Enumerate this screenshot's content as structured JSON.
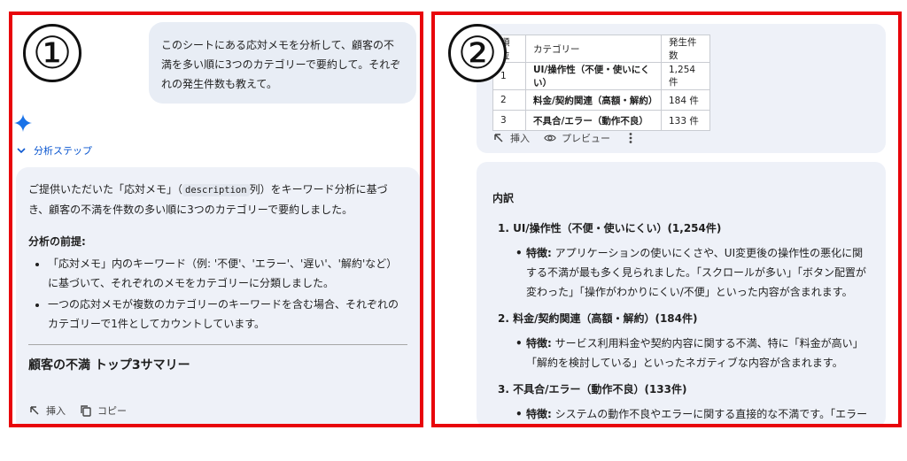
{
  "panel1": {
    "number": "①",
    "user_message": "このシートにある応対メモを分析して、顧客の不満を多い順に3つのカテゴリーで要約して。それぞれの発生件数も教えて。",
    "analysis_steps_label": "分析ステップ",
    "response": {
      "intro_1": "ご提供いただいた「応対メモ」（",
      "intro_code": "description",
      "intro_2": "列）をキーワード分析に基づき、顧客の不満を件数の多い順に3つのカテゴリーで要約しました。",
      "premise_heading": "分析の前提:",
      "bullets": [
        "「応対メモ」内のキーワード（例: '不便'、'エラー'、'遅い'、'解約'など）に基づいて、それぞれのメモをカテゴリーに分類しました。",
        "一つの応対メモが複数のカテゴリーのキーワードを含む場合、それぞれのカテゴリーで1件としてカウントしています。"
      ],
      "summary_title": "顧客の不満 トップ3サマリー"
    },
    "actions": {
      "insert_label": "挿入",
      "copy_label": "コピー"
    }
  },
  "panel2": {
    "number": "②",
    "table": {
      "headers": [
        "順位",
        "カテゴリー",
        "発生件数"
      ],
      "rows": [
        [
          "1",
          "UI/操作性（不便・使いにくい）",
          "1,254 件"
        ],
        [
          "2",
          "料金/契約関連（高額・解約）",
          "184 件"
        ],
        [
          "3",
          "不具合/エラー（動作不良）",
          "133 件"
        ]
      ]
    },
    "actions": {
      "insert_label": "挿入",
      "preview_label": "プレビュー"
    },
    "breakdown": {
      "title": "内訳",
      "items": [
        {
          "title": "1. UI/操作性（不便・使いにくい）(1,254件)",
          "feature_label": "特徴:",
          "feature_text": "アプリケーションの使いにくさや、UI変更後の操作性の悪化に関する不満が最も多く見られました。「スクロールが多い」「ボタン配置が変わった」「操作がわかりにくい/不便」といった内容が含まれます。"
        },
        {
          "title": "2. 料金/契約関連（高額・解約）(184件)",
          "feature_label": "特徴:",
          "feature_text": "サービス利用料金や契約内容に関する不満、特に「料金が高い」「解約を検討している」といったネガティブな内容が含まれます。"
        },
        {
          "title": "3. 不具合/エラー（動作不良）(133件)",
          "feature_label": "特徴:",
          "feature_text": "システムの動作不良やエラーに関する直接的な不満です。「エラーで動かない」「画面が表示されない」「不具合が発生している」といった"
        }
      ]
    }
  },
  "colors": {
    "frame": "#e8050b",
    "card_bg": "#eef1f8",
    "bubble_bg": "#e8edf5",
    "link": "#0b57d0",
    "gemini_star": "#1a73e8"
  }
}
